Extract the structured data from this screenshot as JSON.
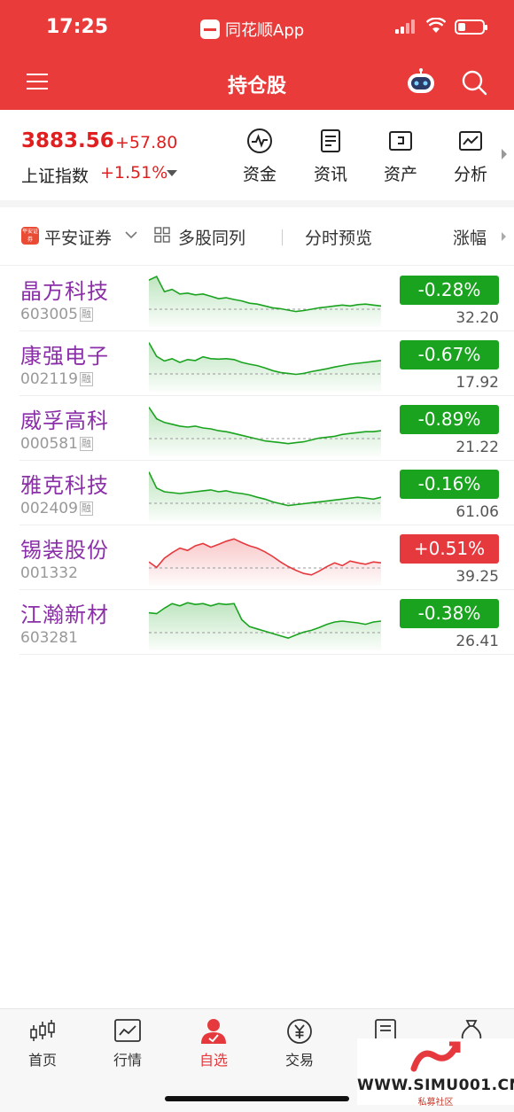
{
  "status_bar": {
    "time": "17:25",
    "app_name": "同花顺App"
  },
  "header": {
    "title": "持仓股"
  },
  "index": {
    "value": "3883.56",
    "change": "+57.80",
    "name": "上证指数",
    "pct": "+1.51%"
  },
  "tools": [
    {
      "label": "资金",
      "icon": "fund-flow-icon"
    },
    {
      "label": "资讯",
      "icon": "news-icon"
    },
    {
      "label": "资产",
      "icon": "asset-icon"
    },
    {
      "label": "分析",
      "icon": "analysis-icon"
    }
  ],
  "filter": {
    "broker": "平安证券",
    "broker_logo_text": "平安证券",
    "multi_stock": "多股同列",
    "preview": "分时预览",
    "sort": "涨幅"
  },
  "stocks": [
    {
      "name": "晶方科技",
      "code": "603005",
      "margin_tag": "融",
      "pct": "-0.28%",
      "price": "32.20",
      "trend": "down",
      "intraday": [
        0.1,
        0.02,
        0.35,
        0.3,
        0.4,
        0.38,
        0.42,
        0.4,
        0.45,
        0.5,
        0.48,
        0.52,
        0.55,
        0.6,
        0.62,
        0.66,
        0.7,
        0.72,
        0.75,
        0.78,
        0.76,
        0.73,
        0.7,
        0.68,
        0.66,
        0.64,
        0.66,
        0.63,
        0.62,
        0.64,
        0.66
      ]
    },
    {
      "name": "康强电子",
      "code": "002119",
      "margin_tag": "融",
      "pct": "-0.67%",
      "price": "17.92",
      "trend": "down",
      "intraday": [
        0.05,
        0.35,
        0.45,
        0.4,
        0.48,
        0.42,
        0.44,
        0.36,
        0.4,
        0.41,
        0.4,
        0.42,
        0.48,
        0.52,
        0.55,
        0.6,
        0.66,
        0.7,
        0.72,
        0.74,
        0.72,
        0.68,
        0.65,
        0.62,
        0.58,
        0.55,
        0.52,
        0.5,
        0.48,
        0.46,
        0.44
      ]
    },
    {
      "name": "威孚高科",
      "code": "000581",
      "margin_tag": "融",
      "pct": "-0.89%",
      "price": "21.22",
      "trend": "down",
      "intraday": [
        0.05,
        0.3,
        0.38,
        0.42,
        0.46,
        0.48,
        0.46,
        0.5,
        0.52,
        0.56,
        0.58,
        0.62,
        0.66,
        0.7,
        0.74,
        0.78,
        0.8,
        0.82,
        0.84,
        0.82,
        0.8,
        0.76,
        0.72,
        0.7,
        0.68,
        0.64,
        0.62,
        0.6,
        0.58,
        0.58,
        0.56
      ]
    },
    {
      "name": "雅克科技",
      "code": "002409",
      "margin_tag": "融",
      "pct": "-0.16%",
      "price": "61.06",
      "trend": "down",
      "intraday": [
        0.05,
        0.4,
        0.48,
        0.5,
        0.52,
        0.5,
        0.48,
        0.46,
        0.44,
        0.48,
        0.46,
        0.5,
        0.52,
        0.55,
        0.6,
        0.64,
        0.7,
        0.74,
        0.78,
        0.76,
        0.74,
        0.72,
        0.7,
        0.68,
        0.66,
        0.64,
        0.62,
        0.6,
        0.62,
        0.64,
        0.6
      ]
    },
    {
      "name": "锡装股份",
      "code": "001332",
      "margin_tag": "",
      "pct": "+0.51%",
      "price": "39.25",
      "trend": "up",
      "intraday": [
        0.6,
        0.72,
        0.52,
        0.4,
        0.3,
        0.35,
        0.25,
        0.2,
        0.28,
        0.22,
        0.15,
        0.1,
        0.18,
        0.25,
        0.3,
        0.38,
        0.48,
        0.6,
        0.7,
        0.78,
        0.85,
        0.88,
        0.8,
        0.7,
        0.62,
        0.68,
        0.58,
        0.62,
        0.65,
        0.6,
        0.62
      ]
    },
    {
      "name": "江瀚新材",
      "code": "603281",
      "margin_tag": "",
      "pct": "-0.38%",
      "price": "26.41",
      "trend": "down",
      "intraday": [
        0.3,
        0.32,
        0.2,
        0.1,
        0.15,
        0.08,
        0.12,
        0.1,
        0.15,
        0.1,
        0.12,
        0.1,
        0.45,
        0.6,
        0.65,
        0.7,
        0.75,
        0.8,
        0.85,
        0.78,
        0.72,
        0.68,
        0.62,
        0.55,
        0.5,
        0.48,
        0.5,
        0.52,
        0.55,
        0.5,
        0.48
      ]
    }
  ],
  "tabs": [
    {
      "label": "首页",
      "icon": "home-candle-icon",
      "active": false
    },
    {
      "label": "行情",
      "icon": "market-chart-icon",
      "active": false
    },
    {
      "label": "自选",
      "icon": "watchlist-user-icon",
      "active": true
    },
    {
      "label": "交易",
      "icon": "trade-yen-icon",
      "active": false
    },
    {
      "label": "资讯",
      "icon": "news-doc-icon",
      "active": false
    },
    {
      "label": "理财",
      "icon": "wealth-bag-icon",
      "active": false
    }
  ],
  "watermark": {
    "text": "WWW.SIMU001.CN",
    "sub": "私募社区"
  },
  "colors": {
    "brand": "#ea3b3b",
    "up": "#e6393e",
    "down": "#1aa31f",
    "name": "#8b2fa8"
  }
}
